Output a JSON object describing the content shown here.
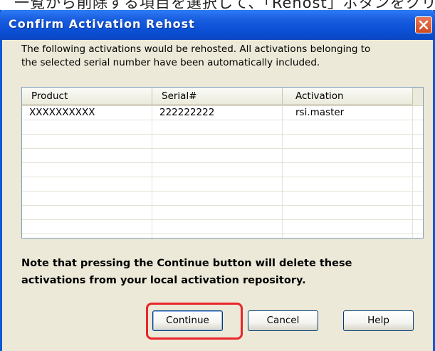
{
  "background": {
    "partial_text": "一覧から削除する項目を選択して、「Rehost」ボタンをクリ"
  },
  "dialog": {
    "title": "Confirm Activation Rehost",
    "close_icon": "close-icon",
    "intro_line1": "The following activations would be rehosted. All activations belonging to",
    "intro_line2": "the selected serial number have been automatically included.",
    "note_line1": "Note that pressing the Continue button will delete these",
    "note_line2": "activations from your local activation repository."
  },
  "table": {
    "columns": [
      "Product",
      "Serial#",
      "Activation"
    ],
    "rows": [
      {
        "product": "XXXXXXXXXX",
        "serial": "222222222",
        "activation": "rsi.master"
      }
    ],
    "empty_rows": 9
  },
  "buttons": {
    "continue_label": "Continue",
    "cancel_label": "Cancel",
    "help_label": "Help"
  },
  "colors": {
    "titlebar": "#0a4fd4",
    "dialog_bg": "#ece9d8",
    "highlight": "#e8262a",
    "close_button": "#d04a20"
  }
}
